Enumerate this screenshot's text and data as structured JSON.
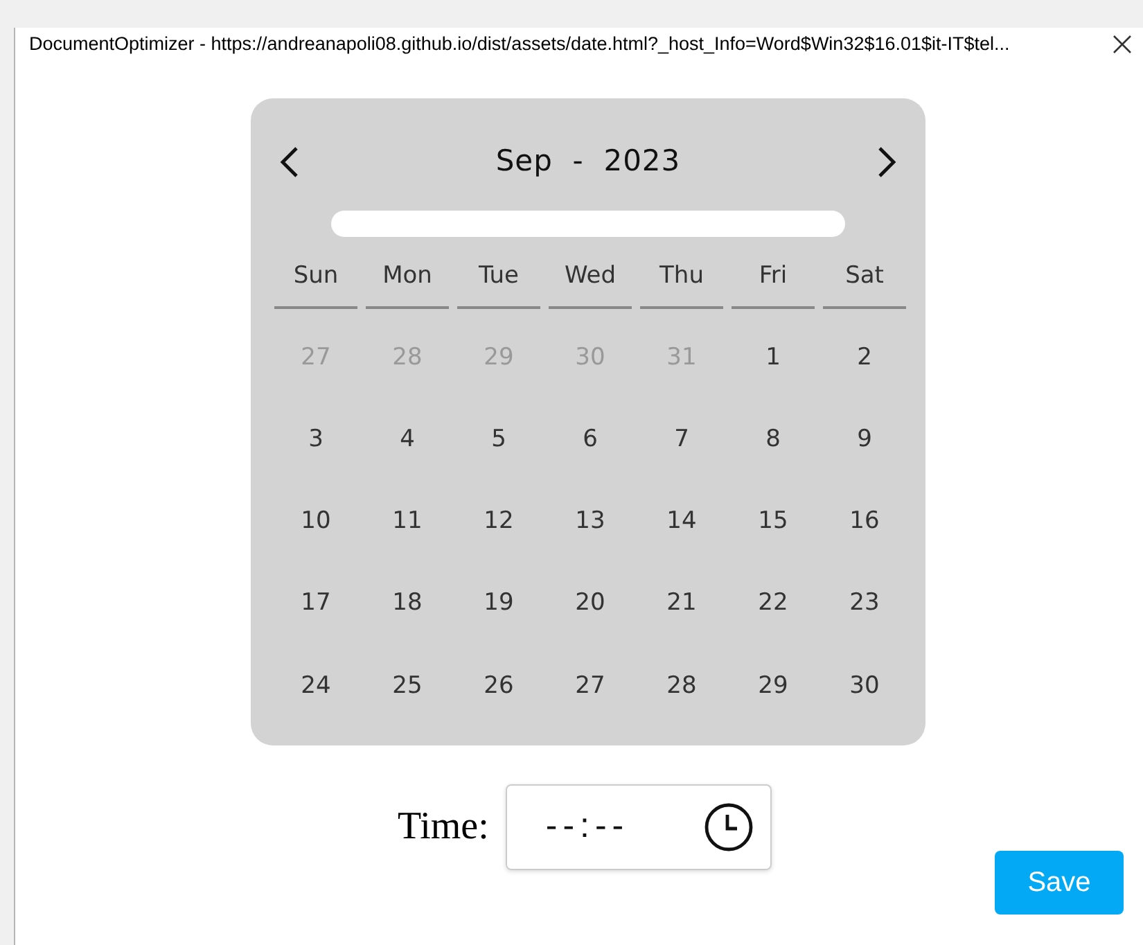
{
  "window": {
    "title": "DocumentOptimizer - https://andreanapoli08.github.io/dist/assets/date.html?_host_Info=Word$Win32$16.01$it-IT$tel..."
  },
  "calendar": {
    "month": "Sep",
    "separator": "-",
    "year": "2023",
    "weekdays": [
      "Sun",
      "Mon",
      "Tue",
      "Wed",
      "Thu",
      "Fri",
      "Sat"
    ],
    "weeks": [
      [
        {
          "day": "27",
          "other_month": true
        },
        {
          "day": "28",
          "other_month": true
        },
        {
          "day": "29",
          "other_month": true
        },
        {
          "day": "30",
          "other_month": true
        },
        {
          "day": "31",
          "other_month": true
        },
        {
          "day": "1",
          "other_month": false
        },
        {
          "day": "2",
          "other_month": false
        }
      ],
      [
        {
          "day": "3",
          "other_month": false
        },
        {
          "day": "4",
          "other_month": false
        },
        {
          "day": "5",
          "other_month": false
        },
        {
          "day": "6",
          "other_month": false
        },
        {
          "day": "7",
          "other_month": false
        },
        {
          "day": "8",
          "other_month": false
        },
        {
          "day": "9",
          "other_month": false
        }
      ],
      [
        {
          "day": "10",
          "other_month": false
        },
        {
          "day": "11",
          "other_month": false
        },
        {
          "day": "12",
          "other_month": false
        },
        {
          "day": "13",
          "other_month": false
        },
        {
          "day": "14",
          "other_month": false
        },
        {
          "day": "15",
          "other_month": false
        },
        {
          "day": "16",
          "other_month": false
        }
      ],
      [
        {
          "day": "17",
          "other_month": false
        },
        {
          "day": "18",
          "other_month": false
        },
        {
          "day": "19",
          "other_month": false
        },
        {
          "day": "20",
          "other_month": false
        },
        {
          "day": "21",
          "other_month": false
        },
        {
          "day": "22",
          "other_month": false
        },
        {
          "day": "23",
          "other_month": false
        }
      ],
      [
        {
          "day": "24",
          "other_month": false
        },
        {
          "day": "25",
          "other_month": false
        },
        {
          "day": "26",
          "other_month": false
        },
        {
          "day": "27",
          "other_month": false
        },
        {
          "day": "28",
          "other_month": false
        },
        {
          "day": "29",
          "other_month": false
        },
        {
          "day": "30",
          "other_month": false
        }
      ]
    ]
  },
  "time": {
    "label": "Time:",
    "placeholder": "--:--"
  },
  "buttons": [
    {
      "label": "Save"
    }
  ]
}
